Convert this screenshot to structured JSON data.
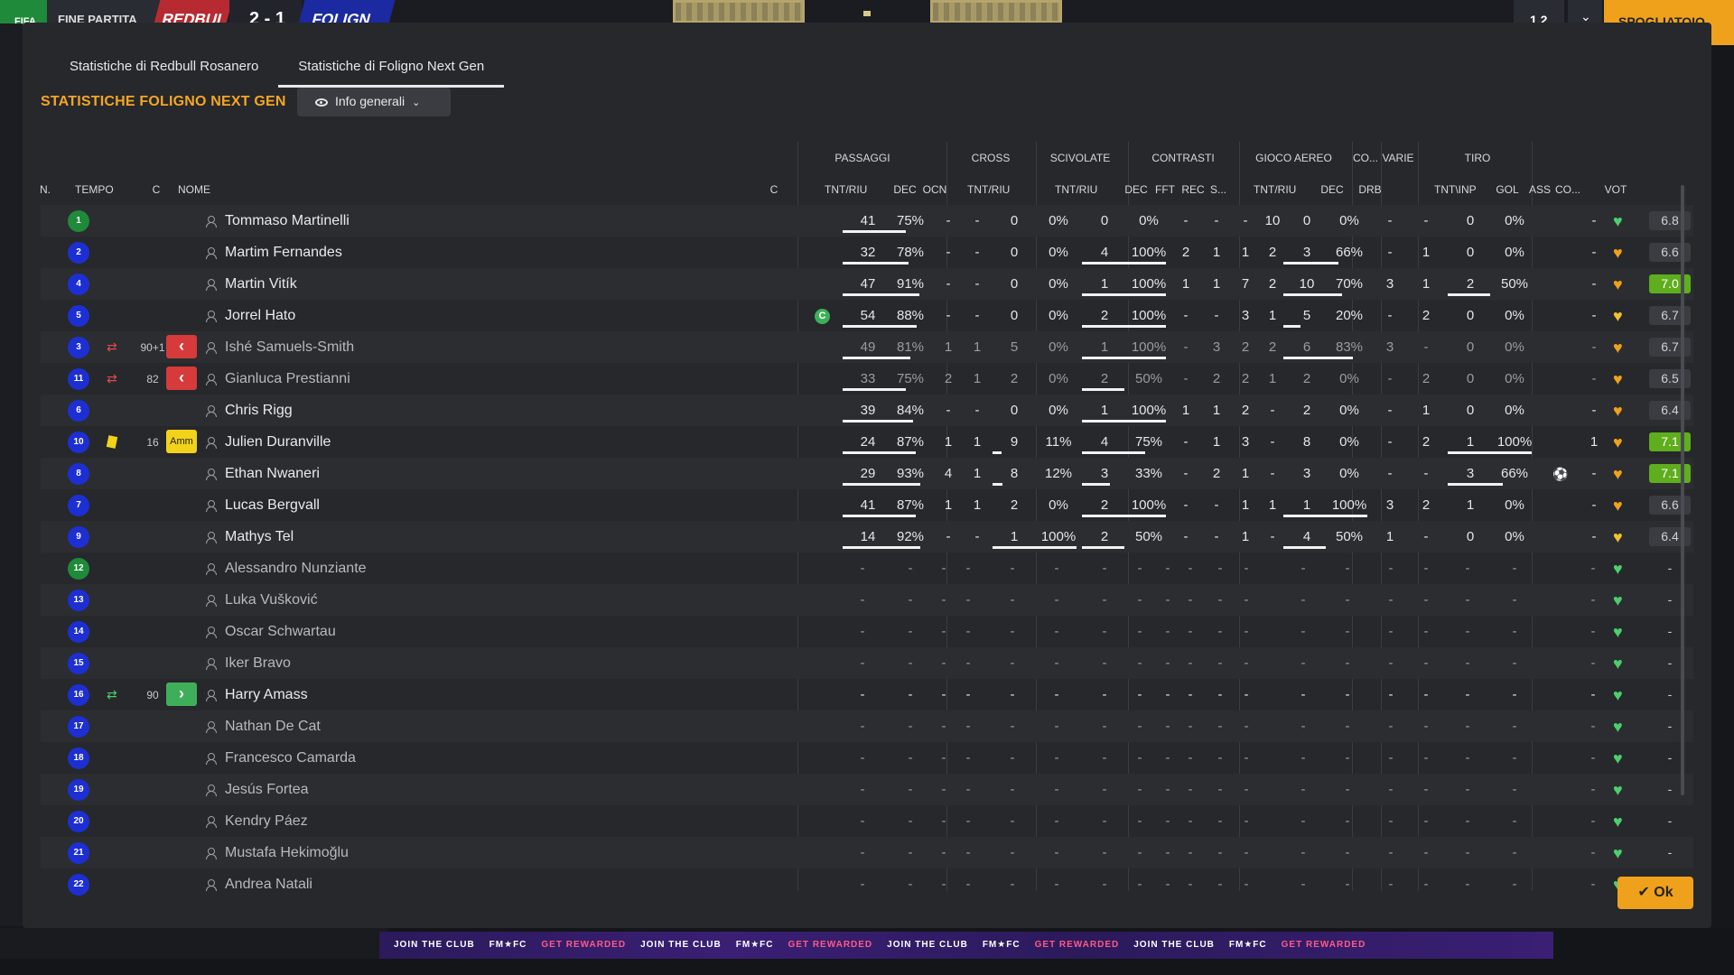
{
  "topbar": {
    "logo": "FIFA",
    "phase": "FINE PARTITA",
    "team_home": "REDBUL",
    "score": "2 - 1",
    "team_away": "FOLIGN",
    "btn_speed": "1.2",
    "btn_changing": "SPOGLIATOIO"
  },
  "tabs": [
    "Statistiche di Redbull Rosanero",
    "Statistiche di Foligno Next Gen"
  ],
  "active_tab": 1,
  "heading": "STATISTICHE FOLIGNO NEXT GEN",
  "view_select": "Info generali",
  "groups": [
    "PASSAGGI",
    "CROSS",
    "SCIVOLATE",
    "CONTRASTI",
    "GIOCO AEREO",
    "CO...",
    "VARIE",
    "TIRO"
  ],
  "columns": [
    "N.",
    "TEMPO",
    "C",
    "NOME",
    "C",
    "TNT/RIU",
    "DEC",
    "OCN",
    "TNT/RIU",
    "TNT/RIU",
    "DEC",
    "FFT",
    "REC",
    "S...",
    "TNT/RIU",
    "DEC",
    "DRB",
    "TNT\\INP",
    "GOL",
    "ASS",
    "CO...",
    "VOT"
  ],
  "colors": {
    "accent": "#f5a623",
    "heart_green": "#4ccf6b",
    "heart_orange": "#f0a11b",
    "vote_good": "#5fae1d"
  },
  "players": [
    {
      "n": "1",
      "gk": true,
      "name": "Tommaso Martinelli",
      "pt": "41",
      "pp": "75%",
      "pf": 0.75,
      "dec": "-",
      "ocn": "-",
      "ct": "0",
      "cp": "0%",
      "cf": 0,
      "st": "0",
      "sp": "0%",
      "sf": 0,
      "cd": "-",
      "cff": "-",
      "cr": "-",
      "cs": "10",
      "at": "0",
      "ap": "0%",
      "af": 0,
      "co": "-",
      "drb": "-",
      "tt": "0",
      "tp": "0%",
      "tf": 0,
      "gol": "",
      "ass": "-",
      "heart": "green",
      "vote": "6.8",
      "vote_style": "mid"
    },
    {
      "n": "2",
      "name": "Martim Fernandes",
      "pt": "32",
      "pp": "78%",
      "pf": 0.78,
      "dec": "-",
      "ocn": "-",
      "ct": "0",
      "cp": "0%",
      "cf": 0,
      "st": "4",
      "sp": "100%",
      "sf": 1,
      "cd": "2",
      "cff": "1",
      "cr": "1",
      "cs": "2",
      "at": "3",
      "ap": "66%",
      "af": 0.66,
      "co": "-",
      "drb": "1",
      "tt": "0",
      "tp": "0%",
      "tf": 0,
      "gol": "",
      "ass": "-",
      "heart": "orange",
      "vote": "6.6",
      "vote_style": "mid"
    },
    {
      "n": "4",
      "name": "Martin Vitík",
      "pt": "47",
      "pp": "91%",
      "pf": 0.91,
      "dec": "-",
      "ocn": "-",
      "ct": "0",
      "cp": "0%",
      "cf": 0,
      "st": "1",
      "sp": "100%",
      "sf": 1,
      "cd": "1",
      "cff": "1",
      "cr": "7",
      "cs": "2",
      "at": "10",
      "ap": "70%",
      "af": 0.7,
      "co": "3",
      "drb": "1",
      "tt": "2",
      "tp": "50%",
      "tf": 0.5,
      "gol": "",
      "ass": "-",
      "heart": "orange",
      "vote": "7.0",
      "vote_style": "good"
    },
    {
      "n": "5",
      "name": "Jorrel Hato",
      "captain": "C",
      "pt": "54",
      "pp": "88%",
      "pf": 0.88,
      "dec": "-",
      "ocn": "-",
      "ct": "0",
      "cp": "0%",
      "cf": 0,
      "st": "2",
      "sp": "100%",
      "sf": 1,
      "cd": "-",
      "cff": "-",
      "cr": "3",
      "cs": "1",
      "at": "5",
      "ap": "20%",
      "af": 0.2,
      "co": "-",
      "drb": "2",
      "tt": "0",
      "tp": "0%",
      "tf": 0,
      "gol": "",
      "ass": "-",
      "heart": "yellow",
      "vote": "6.7",
      "vote_style": "mid"
    },
    {
      "n": "3",
      "name": "Ishé Samuels-Smith",
      "dim": true,
      "sub": "out",
      "tempo": "90+1",
      "badge": "red",
      "badge_text": "‹",
      "pt": "49",
      "pp": "81%",
      "pf": 0.81,
      "dec": "1",
      "ocn": "1",
      "ct": "5",
      "cp": "0%",
      "cf": 0,
      "st": "1",
      "sp": "100%",
      "sf": 1,
      "cd": "-",
      "cff": "3",
      "cr": "2",
      "cs": "2",
      "at": "6",
      "ap": "83%",
      "af": 0.83,
      "co": "3",
      "drb": "-",
      "tt": "0",
      "tp": "0%",
      "tf": 0,
      "gol": "",
      "ass": "-",
      "heart": "orange",
      "vote": "6.7",
      "vote_style": "mid"
    },
    {
      "n": "11",
      "name": "Gianluca Prestianni",
      "dim": true,
      "sub": "out",
      "tempo": "82",
      "badge": "red",
      "badge_text": "‹",
      "pt": "33",
      "pp": "75%",
      "pf": 0.75,
      "dec": "2",
      "ocn": "1",
      "ct": "2",
      "cp": "0%",
      "cf": 0,
      "st": "2",
      "sp": "50%",
      "sf": 0.5,
      "cd": "-",
      "cff": "2",
      "cr": "2",
      "cs": "1",
      "at": "2",
      "ap": "0%",
      "af": 0,
      "co": "-",
      "drb": "2",
      "tt": "0",
      "tp": "0%",
      "tf": 0,
      "gol": "",
      "ass": "-",
      "heart": "orange",
      "vote": "6.5",
      "vote_style": "mid"
    },
    {
      "n": "6",
      "name": "Chris Rigg",
      "pt": "39",
      "pp": "84%",
      "pf": 0.84,
      "dec": "-",
      "ocn": "-",
      "ct": "0",
      "cp": "0%",
      "cf": 0,
      "st": "1",
      "sp": "100%",
      "sf": 1,
      "cd": "1",
      "cff": "1",
      "cr": "2",
      "cs": "-",
      "at": "2",
      "ap": "0%",
      "af": 0,
      "co": "-",
      "drb": "1",
      "tt": "0",
      "tp": "0%",
      "tf": 0,
      "gol": "",
      "ass": "-",
      "heart": "orange",
      "vote": "6.4",
      "vote_style": "mid"
    },
    {
      "n": "10",
      "name": "Julien Duranville",
      "yellow": true,
      "tempo": "16",
      "badge": "amm",
      "badge_text": "Amm",
      "pt": "24",
      "pp": "87%",
      "pf": 0.87,
      "dec": "1",
      "ocn": "1",
      "ct": "9",
      "cp": "11%",
      "cf": 0.11,
      "st": "4",
      "sp": "75%",
      "sf": 0.75,
      "cd": "-",
      "cff": "1",
      "cr": "3",
      "cs": "-",
      "at": "8",
      "ap": "0%",
      "af": 0,
      "co": "-",
      "drb": "2",
      "tt": "1",
      "tp": "100%",
      "tf": 1,
      "gol": "",
      "ass": "1",
      "heart": "orange",
      "vote": "7.1",
      "vote_style": "good"
    },
    {
      "n": "8",
      "name": "Ethan Nwaneri",
      "pt": "29",
      "pp": "93%",
      "pf": 0.93,
      "dec": "4",
      "ocn": "1",
      "ct": "8",
      "cp": "12%",
      "cf": 0.12,
      "st": "3",
      "sp": "33%",
      "sf": 0.33,
      "cd": "-",
      "cff": "2",
      "cr": "1",
      "cs": "-",
      "at": "3",
      "ap": "0%",
      "af": 0,
      "co": "-",
      "drb": "-",
      "tt": "3",
      "tp": "66%",
      "tf": 0.66,
      "gol": "⚽",
      "ass": "-",
      "heart": "orange",
      "vote": "7.1",
      "vote_style": "good"
    },
    {
      "n": "7",
      "name": "Lucas Bergvall",
      "pt": "41",
      "pp": "87%",
      "pf": 0.87,
      "dec": "1",
      "ocn": "1",
      "ct": "2",
      "cp": "0%",
      "cf": 0,
      "st": "2",
      "sp": "100%",
      "sf": 1,
      "cd": "-",
      "cff": "-",
      "cr": "1",
      "cs": "1",
      "at": "1",
      "ap": "100%",
      "af": 1,
      "co": "3",
      "drb": "2",
      "tt": "1",
      "tp": "0%",
      "tf": 0,
      "gol": "",
      "ass": "-",
      "heart": "orange",
      "vote": "6.6",
      "vote_style": "mid"
    },
    {
      "n": "9",
      "name": "Mathys Tel",
      "pt": "14",
      "pp": "92%",
      "pf": 0.92,
      "dec": "-",
      "ocn": "-",
      "ct": "1",
      "cp": "100%",
      "cf": 1,
      "st": "2",
      "sp": "50%",
      "sf": 0.5,
      "cd": "-",
      "cff": "-",
      "cr": "1",
      "cs": "-",
      "at": "4",
      "ap": "50%",
      "af": 0.5,
      "co": "1",
      "drb": "-",
      "tt": "0",
      "tp": "0%",
      "tf": 0,
      "gol": "",
      "ass": "-",
      "heart": "yellow",
      "vote": "6.4",
      "vote_style": "mid"
    },
    {
      "n": "12",
      "gk": true,
      "name": "Alessandro Nunziante",
      "dim": true,
      "bench": true,
      "heart": "green",
      "vote": "-"
    },
    {
      "n": "13",
      "name": "Luka Vušković",
      "dim": true,
      "bench": true,
      "heart": "green",
      "vote": "-"
    },
    {
      "n": "14",
      "name": "Oscar Schwartau",
      "dim": true,
      "bench": true,
      "heart": "green",
      "vote": "-"
    },
    {
      "n": "15",
      "name": "Iker Bravo",
      "dim": true,
      "bench": true,
      "heart": "green",
      "vote": "-"
    },
    {
      "n": "16",
      "name": "Harry Amass",
      "sub": "in",
      "tempo": "90",
      "badge": "green",
      "badge_text": "›",
      "bench": true,
      "heart": "green",
      "vote": "-"
    },
    {
      "n": "17",
      "name": "Nathan De Cat",
      "dim": true,
      "bench": true,
      "heart": "green",
      "vote": "-"
    },
    {
      "n": "18",
      "name": "Francesco Camarda",
      "dim": true,
      "bench": true,
      "heart": "green",
      "vote": "-"
    },
    {
      "n": "19",
      "name": "Jesús Fortea",
      "dim": true,
      "bench": true,
      "heart": "green",
      "vote": "-"
    },
    {
      "n": "20",
      "name": "Kendry Páez",
      "dim": true,
      "bench": true,
      "heart": "green",
      "vote": "-"
    },
    {
      "n": "21",
      "name": "Mustafa Hekimoğlu",
      "dim": true,
      "bench": true,
      "heart": "green",
      "vote": "-"
    },
    {
      "n": "22",
      "name": "Andrea Natali",
      "dim": true,
      "bench": true,
      "heart": "green",
      "vote": "-"
    }
  ],
  "ok_button": "Ok",
  "bottom_banner": [
    "JOIN THE CLUB",
    "FM★FC",
    "GET REWARDED"
  ]
}
